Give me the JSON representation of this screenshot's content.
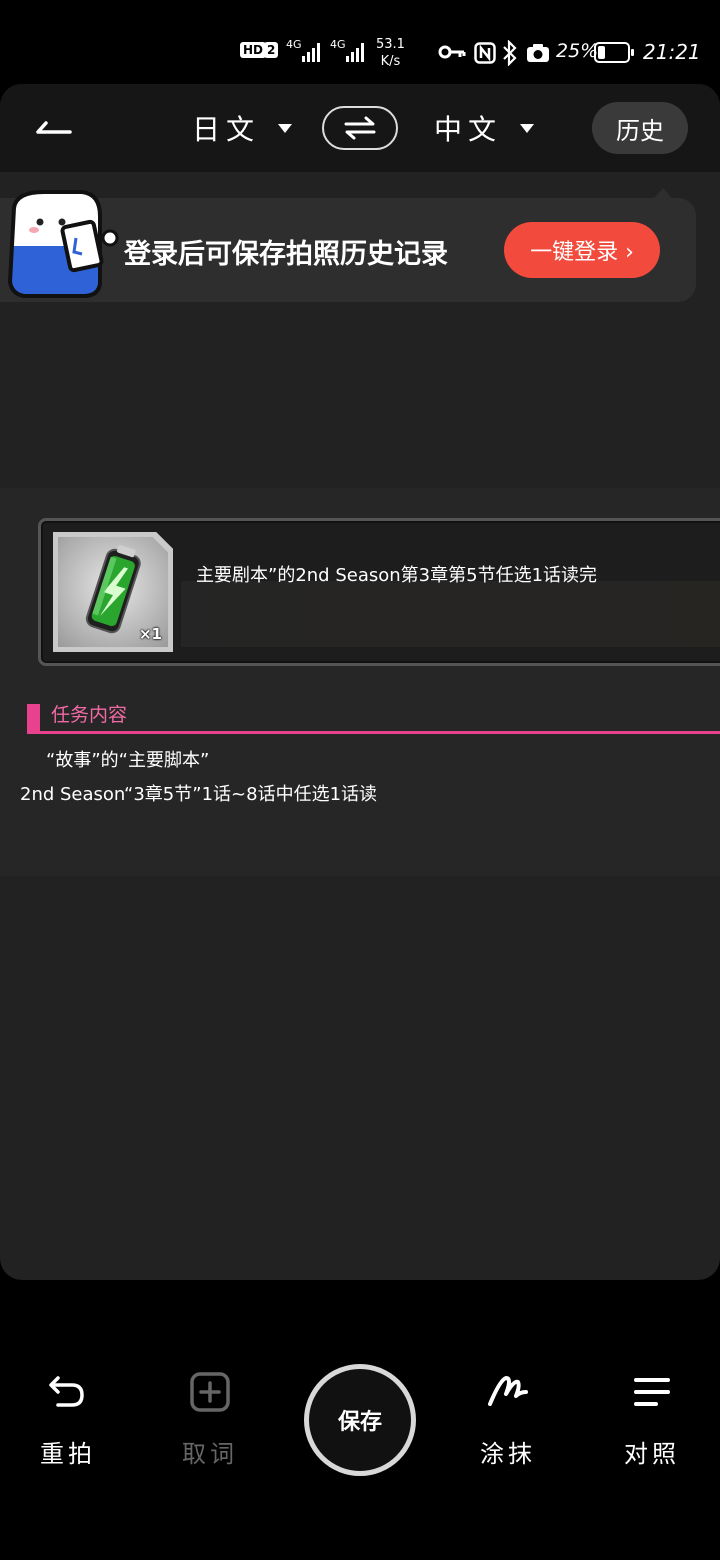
{
  "status_bar": {
    "hd": "HD",
    "sim": "2",
    "net1": "4G",
    "net2": "4G",
    "speed_value": "53.1",
    "speed_unit": "K/s",
    "battery_pct": "25%",
    "battery_level": 0.25,
    "time": "21:21",
    "icons": [
      "key-icon",
      "nfc-icon",
      "bluetooth-icon",
      "camera-icon",
      "battery-icon"
    ]
  },
  "topbar": {
    "source_lang": "日文",
    "target_lang": "中文",
    "history_label": "历史"
  },
  "login_banner": {
    "text": "登录后可保存拍照历史记录",
    "button_label": "一键登录 ›"
  },
  "translation": {
    "mission_title": "主要剧本”的2nd Season第3章第5节任选1话读完",
    "item_qty": "×1",
    "section_title": "任务内容",
    "desc_line1": "“故事”的“主要脚本”",
    "desc_line2": "2nd Season“3章5节”1话~8话中任选1话读"
  },
  "colors": {
    "accent_red": "#f24a3c",
    "section_pink": "#e8418e",
    "battery_green": "#3bd34a"
  },
  "toolbar": {
    "retake_label": "重拍",
    "pick_word_label": "取词",
    "save_label": "保存",
    "erase_label": "涂抹",
    "compare_label": "对照"
  }
}
